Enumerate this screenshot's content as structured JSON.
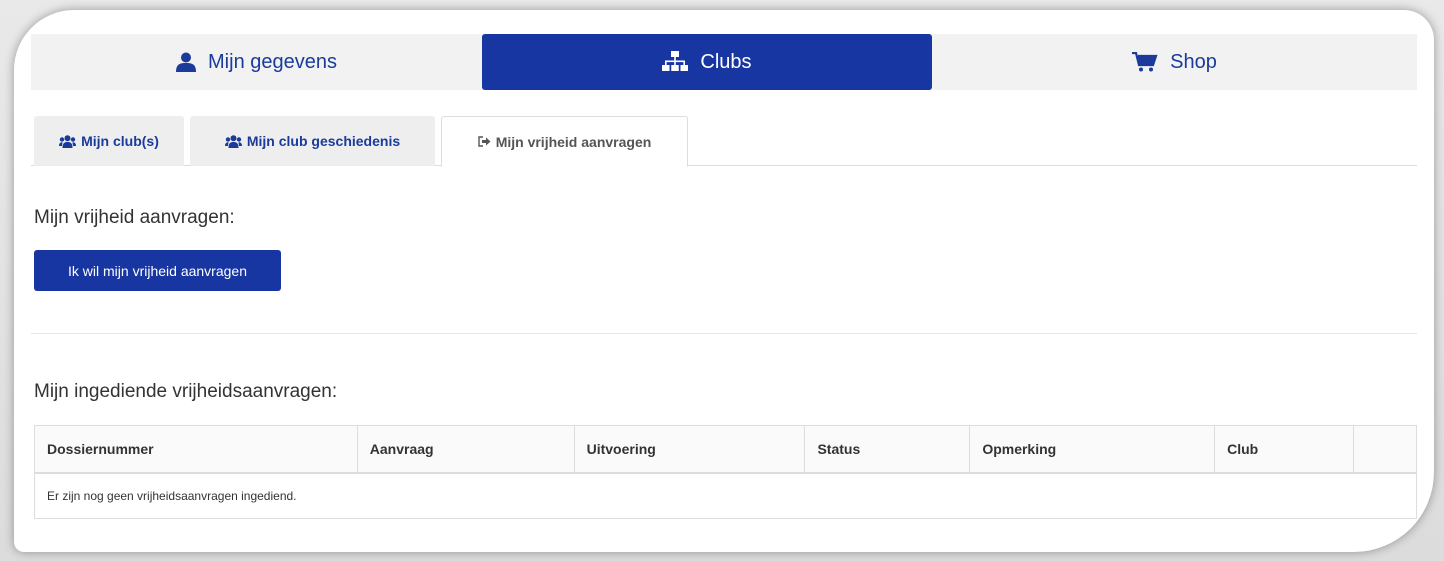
{
  "topnav": {
    "items": [
      {
        "label": "Mijn gegevens",
        "icon": "user-icon"
      },
      {
        "label": "Clubs",
        "icon": "sitemap-icon",
        "active": true
      },
      {
        "label": "Shop",
        "icon": "cart-icon"
      }
    ]
  },
  "subtabs": {
    "items": [
      {
        "label": "Mijn club(s)",
        "icon": "users-icon"
      },
      {
        "label": "Mijn club geschiedenis",
        "icon": "users-icon"
      },
      {
        "label": "Mijn vrijheid aanvragen",
        "icon": "sign-out-icon",
        "active": true
      }
    ]
  },
  "main": {
    "title": "Mijn vrijheid aanvragen:",
    "request_button": "Ik wil mijn vrijheid aanvragen",
    "submitted_title": "Mijn ingediende vrijheidsaanvragen:"
  },
  "table": {
    "headers": [
      "Dossiernummer",
      "Aanvraag",
      "Uitvoering",
      "Status",
      "Opmerking",
      "Club",
      ""
    ],
    "empty_message": "Er zijn nog geen vrijheidsaanvragen ingediend."
  },
  "colors": {
    "primary": "#1736a1",
    "link": "#1a3b9c",
    "tab_bg": "#eeeeee"
  }
}
